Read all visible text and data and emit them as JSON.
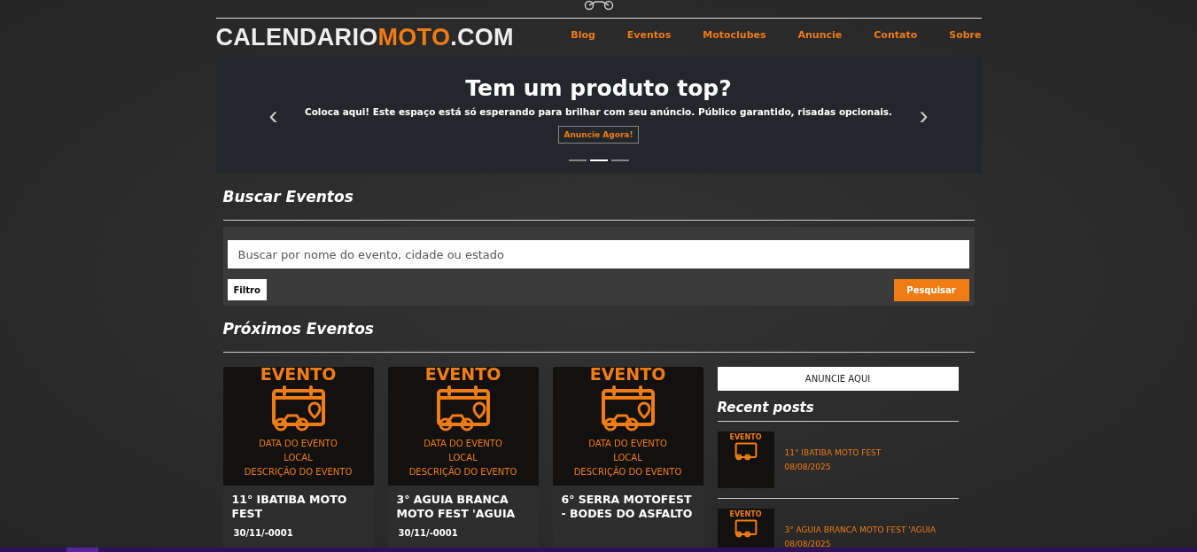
{
  "header": {
    "logo_parts": [
      {
        "text": "CALENDARIO",
        "accent": false
      },
      {
        "text": "MOTO",
        "accent": true
      },
      {
        "text": ".COM",
        "accent": false
      }
    ],
    "nav": [
      "Blog",
      "Eventos",
      "Motoclubes",
      "Anuncie",
      "Contato",
      "Sobre"
    ]
  },
  "banner": {
    "title": "Tem um produto top?",
    "text": "Coloca aqui! Este espaço está só esperando para brilhar com seu anúncio. Público garantido, risadas opcionais.",
    "button": "Anuncie Agora!",
    "prev": "‹",
    "next": "›",
    "dots": [
      {
        "selected": false
      },
      {
        "selected": true
      },
      {
        "selected": false
      }
    ]
  },
  "search": {
    "heading": "Buscar Eventos",
    "placeholder": "Buscar por nome do evento, cidade ou estado",
    "filter_button": "Filtro",
    "submit_button": "Pesquisar"
  },
  "events": {
    "heading": "Próximos Eventos",
    "cards": [
      {
        "poster": {
          "title": "EVENTO",
          "lines": [
            "DATA DO EVENTO",
            "LOCAL",
            "DESCRIÇÃO DO EVENTO"
          ]
        },
        "title": "11° IBATIBA MOTO FEST",
        "date": "30/11/-0001"
      },
      {
        "poster": {
          "title": "EVENTO",
          "lines": [
            "DATA DO EVENTO",
            "LOCAL",
            "DESCRIÇÃO DO EVENTO"
          ]
        },
        "title": "3° AGUIA BRANCA MOTO FEST 'AGUIA",
        "date": "30/11/-0001"
      },
      {
        "poster": {
          "title": "EVENTO",
          "lines": [
            "DATA DO EVENTO",
            "LOCAL",
            "DESCRIÇÃO DO EVENTO"
          ]
        },
        "title": "6° SERRA MOTOFEST - BODES DO ASFALTO"
      }
    ]
  },
  "sidebar": {
    "ad_button": "ANUNCIE AQUI",
    "heading": "Recent posts",
    "posts": [
      {
        "poster": {
          "title": "EVENTO"
        },
        "title": "11° IBATIBA MOTO FEST",
        "date": "08/08/2025"
      },
      {
        "poster": {
          "title": "EVENTO"
        },
        "title": "3° AGUIA BRANCA MOTO FEST 'AGUIA",
        "date": "08/08/2025"
      }
    ]
  }
}
